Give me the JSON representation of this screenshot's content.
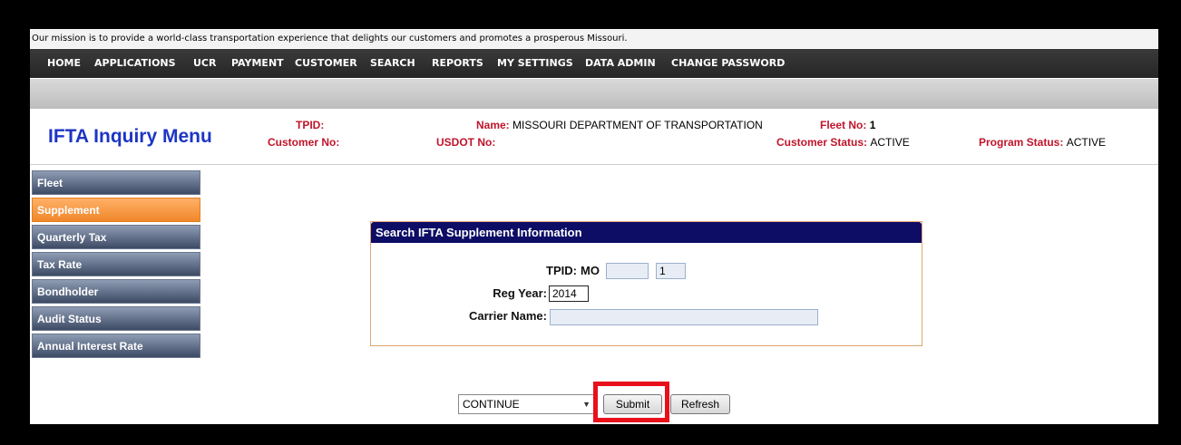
{
  "mission_text": "Our mission is to provide a world-class transportation experience that delights our customers and promotes a prosperous Missouri.",
  "nav": [
    "HOME",
    "APPLICATIONS",
    "UCR",
    "PAYMENT",
    "CUSTOMER",
    "SEARCH",
    "REPORTS",
    "MY SETTINGS",
    "DATA ADMIN",
    "CHANGE PASSWORD"
  ],
  "header": {
    "title": "IFTA Inquiry Menu",
    "tpid_label": "TPID:",
    "customer_no_label": "Customer No:",
    "name_label": "Name:",
    "name_value": "MISSOURI DEPARTMENT OF TRANSPORTATION",
    "usdot_label": "USDOT No:",
    "fleet_label": "Fleet No:",
    "fleet_value": "1",
    "customer_status_label": "Customer Status:",
    "customer_status_value": "ACTIVE",
    "program_status_label": "Program Status:",
    "program_status_value": "ACTIVE"
  },
  "sidebar": [
    "Fleet",
    "Supplement",
    "Quarterly Tax",
    "Tax Rate",
    "Bondholder",
    "Audit Status",
    "Annual Interest Rate"
  ],
  "sidebar_active": "Supplement",
  "panel": {
    "title": "Search IFTA Supplement Information",
    "tpid_label": "TPID:",
    "tpid_prefix": "MO",
    "tpid_number": "",
    "tpid_suffix": "1",
    "reg_year_label": "Reg Year:",
    "reg_year_value": "2014",
    "carrier_name_label": "Carrier Name:",
    "carrier_name_value": ""
  },
  "actions": {
    "select_value": "CONTINUE",
    "submit_label": "Submit",
    "refresh_label": "Refresh"
  },
  "colors": {
    "title_blue": "#1d35c4",
    "label_red": "#c0142b",
    "active_orange": "#f0872a",
    "panel_header_navy": "#0d0d66",
    "highlight_red": "#e8101a"
  }
}
